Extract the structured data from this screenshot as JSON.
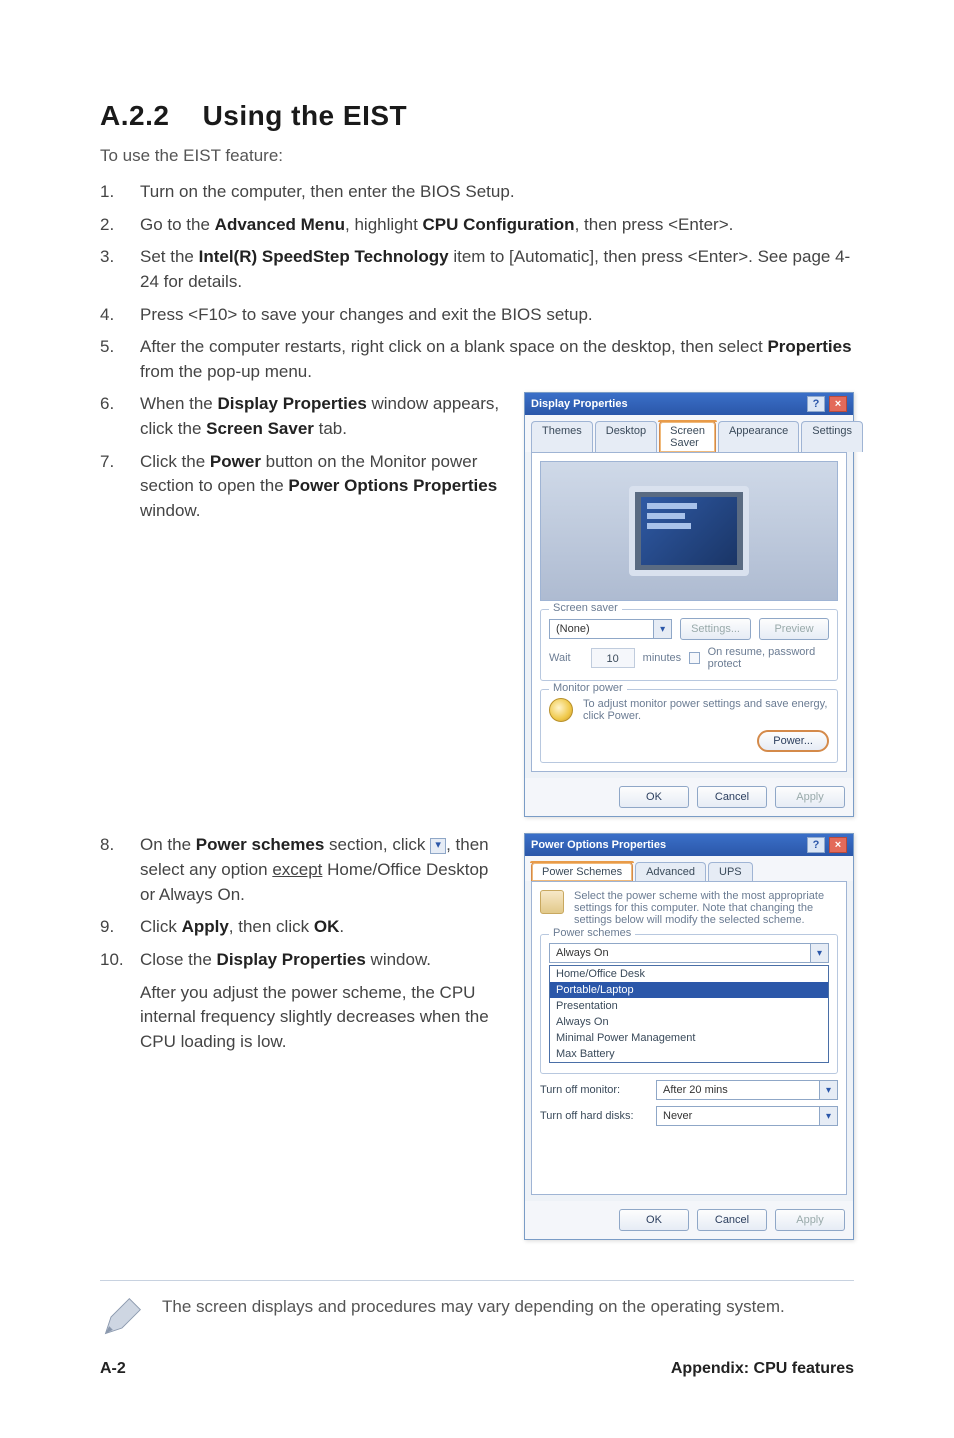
{
  "heading": {
    "number": "A.2.2",
    "title": "Using the EIST"
  },
  "intro": "To use the EIST feature:",
  "steps_top": [
    {
      "n": "1.",
      "parts": [
        "Turn on the computer, then enter the BIOS Setup."
      ]
    },
    {
      "n": "2.",
      "parts": [
        "Go to the ",
        {
          "b": "Advanced Menu"
        },
        ", highlight ",
        {
          "b": "CPU Configuration"
        },
        ", then press <Enter>."
      ]
    },
    {
      "n": "3.",
      "parts": [
        "Set the ",
        {
          "b": "Intel(R) SpeedStep Technology"
        },
        " item to [Automatic], then press <Enter>. See page 4-24 for details."
      ]
    },
    {
      "n": "4.",
      "parts": [
        "Press <F10> to save your changes and exit the BIOS setup."
      ]
    },
    {
      "n": "5.",
      "parts": [
        "After the computer restarts, right click on a blank space on the desktop, then select ",
        {
          "b": "Properties"
        },
        " from the pop-up menu."
      ]
    }
  ],
  "steps_mid": [
    {
      "n": "6.",
      "parts": [
        "When the ",
        {
          "b": "Display Properties"
        },
        " window appears, click the ",
        {
          "b": "Screen Saver"
        },
        " tab."
      ]
    },
    {
      "n": "7.",
      "parts": [
        "Click the ",
        {
          "b": "Power"
        },
        " button on the Monitor power section to open the ",
        {
          "b": "Power Options Properties"
        },
        " window."
      ]
    }
  ],
  "steps_low": [
    {
      "n": "8.",
      "parts": [
        "On the ",
        {
          "b": "Power schemes"
        },
        " section, click "
      ],
      "after_arrow": [
        ", then select any option ",
        {
          "u": "except"
        },
        " Home/Office Desktop or Always On."
      ]
    },
    {
      "n": "9.",
      "parts": [
        "Click ",
        {
          "b": "Apply"
        },
        ", then click ",
        {
          "b": "OK"
        },
        "."
      ]
    },
    {
      "n": "10.",
      "parts": [
        "Close the ",
        {
          "b": "Display Properties"
        },
        " window."
      ]
    }
  ],
  "post_text": "After you adjust the power scheme, the CPU internal frequency slightly decreases when the CPU loading is low.",
  "note": "The screen displays and procedures may vary depending on the operating system.",
  "display_props": {
    "title": "Display Properties",
    "tabs": [
      "Themes",
      "Desktop",
      "Screen Saver",
      "Appearance",
      "Settings"
    ],
    "active_tab_index": 2,
    "ss_group": "Screen saver",
    "ss_select": "(None)",
    "ss_settings_btn": "Settings...",
    "ss_preview_btn": "Preview",
    "wait_label": "Wait",
    "wait_value": "10",
    "wait_suffix": "minutes",
    "resume_label": "On resume, password protect",
    "mp_group": "Monitor power",
    "mp_text": "To adjust monitor power settings and save energy, click Power.",
    "power_btn": "Power...",
    "ok_btn": "OK",
    "cancel_btn": "Cancel",
    "apply_btn": "Apply"
  },
  "power_opts": {
    "title": "Power Options Properties",
    "tabs": [
      "Power Schemes",
      "Advanced",
      "UPS"
    ],
    "active_tab_index": 0,
    "desc": "Select the power scheme with the most appropriate settings for this computer. Note that changing the settings below will modify the selected scheme.",
    "schemes_group": "Power schemes",
    "scheme_selected": "Always On",
    "scheme_options": [
      "Home/Office Desk",
      "Portable/Laptop",
      "Presentation",
      "Always On",
      "Minimal Power Management",
      "Max Battery"
    ],
    "scheme_highlight_index": 1,
    "turnoff_mon_label": "Turn off monitor:",
    "turnoff_mon_value": "After 20 mins",
    "turnoff_hd_label": "Turn off hard disks:",
    "turnoff_hd_value": "Never",
    "ok_btn": "OK",
    "cancel_btn": "Cancel",
    "apply_btn": "Apply"
  },
  "footer": {
    "page": "A-2",
    "chapter": "Appendix: CPU features"
  }
}
